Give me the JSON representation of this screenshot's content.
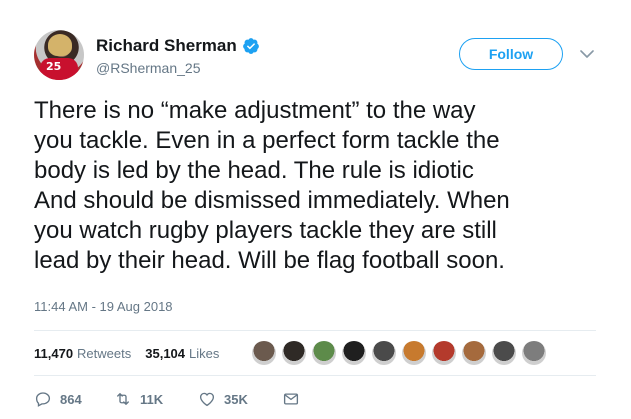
{
  "author": {
    "display_name": "Richard Sherman",
    "handle": "@RSherman_25",
    "verified_icon": "verified-badge-icon",
    "avatar_jersey_number": "25"
  },
  "follow_button": {
    "label": "Follow"
  },
  "menu_icon": "chevron-down-icon",
  "tweet": {
    "lines": [
      "There is no “make adjustment” to the way",
      "you tackle.  Even in a perfect form tackle the",
      "body is led by the head.  The rule is idiotic",
      "And should be dismissed immediately.  When",
      "you watch rugby players tackle they are still",
      "lead by their head.  Will be flag football soon."
    ],
    "timestamp": "11:44 AM - 19 Aug 2018"
  },
  "stats": {
    "retweets_count": "11,470",
    "retweets_label": "Retweets",
    "likes_count": "35,104",
    "likes_label": "Likes",
    "liker_avatar_colors": [
      "#6b5a4e",
      "#2f2a26",
      "#5d8b4a",
      "#1f1f1f",
      "#4a4a4a",
      "#c77a2e",
      "#b43a2c",
      "#a56a3d",
      "#4b4b4b",
      "#7d7d7d"
    ]
  },
  "actions": {
    "reply_count": "864",
    "retweet_count": "11K",
    "like_count": "35K",
    "icons": [
      "reply-icon",
      "retweet-icon",
      "heart-icon",
      "direct-message-icon"
    ]
  },
  "colors": {
    "accent": "#1da1f2",
    "text": "#14171a",
    "muted": "#657786",
    "divider": "#e6ecf0"
  }
}
